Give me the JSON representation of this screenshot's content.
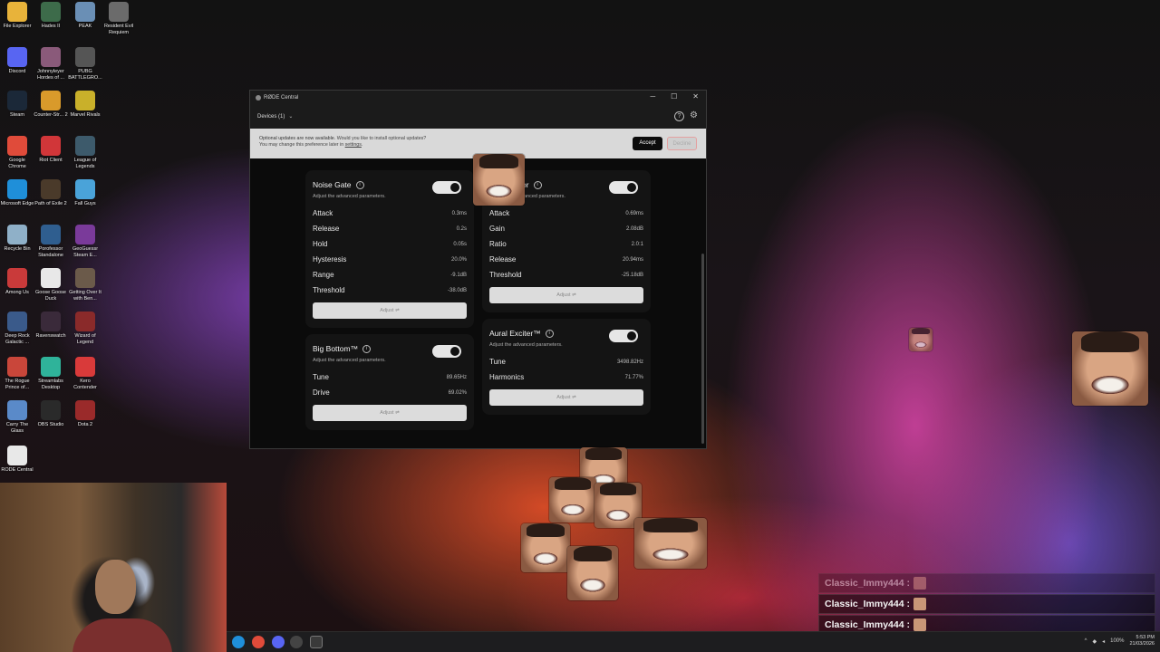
{
  "desktop": {
    "icons": [
      {
        "label": "File Explorer",
        "color": "#e8b33a"
      },
      {
        "label": "Hades II",
        "color": "#3d6b4a"
      },
      {
        "label": "PEAK",
        "color": "#6a8fb5"
      },
      {
        "label": "Resident Evil Requiem",
        "color": "#6b6b6b"
      },
      {
        "label": "Discord",
        "color": "#5865f2"
      },
      {
        "label": "Johnnyleyer Hordes of ...",
        "color": "#8a5a7a"
      },
      {
        "label": "PUBG BATTLEGRO...",
        "color": "#555555"
      },
      {
        "label": "Steam",
        "color": "#1b2838"
      },
      {
        "label": "Counter-Str... 2",
        "color": "#d99a2b"
      },
      {
        "label": "Marvel Rivals",
        "color": "#c9b02a"
      },
      {
        "label": "Google Chrome",
        "color": "#e04b3a"
      },
      {
        "label": "Riot Client",
        "color": "#d13639"
      },
      {
        "label": "League of Legends",
        "color": "#3d5a6b"
      },
      {
        "label": "Microsoft Edge",
        "color": "#1f8fd9"
      },
      {
        "label": "Path of Exile 2",
        "color": "#4a3a2a"
      },
      {
        "label": "Fall Guys",
        "color": "#4aa3d9"
      },
      {
        "label": "Recycle Bin",
        "color": "#8fb0c8"
      },
      {
        "label": "Porofessor Standalone",
        "color": "#2f5e8f"
      },
      {
        "label": "GeoGuessr Steam E...",
        "color": "#7a3a9a"
      },
      {
        "label": "Among Us",
        "color": "#c93a3a"
      },
      {
        "label": "Goose Goose Duck",
        "color": "#e8e8e8"
      },
      {
        "label": "Getting Over It with Ben...",
        "color": "#6b5a4a"
      },
      {
        "label": "Deep Rock Galactic ...",
        "color": "#3a5a8a"
      },
      {
        "label": "Ravenswatch",
        "color": "#3a2a3a"
      },
      {
        "label": "Wizard of Legend",
        "color": "#8a2a2a"
      },
      {
        "label": "The Rogue Prince of...",
        "color": "#c9463a"
      },
      {
        "label": "Streamlabs Desktop",
        "color": "#2fb39a"
      },
      {
        "label": "Kero Contender",
        "color": "#d93a3a"
      },
      {
        "label": "Carry The Glass",
        "color": "#5a8ac9"
      },
      {
        "label": "OBS Studio",
        "color": "#2a2a2a"
      },
      {
        "label": "Dota 2",
        "color": "#9a2a2a"
      },
      {
        "label": "RODE Central",
        "color": "#e8e8e8"
      }
    ]
  },
  "window": {
    "title": "RØDE Central",
    "controls": {
      "minimize": "─",
      "maximize": "☐",
      "close": "✕"
    },
    "devices_label": "Devices (1)",
    "devices_chevron": "⌄",
    "help_icon": "?",
    "settings_icon": "⚙"
  },
  "banner": {
    "line1_strong": "Optional updates are now available.",
    "line1_rest": " Would you like to install optional updates?",
    "line2_pre": "You may change this preference later in ",
    "line2_link": "settings",
    "line2_post": ".",
    "accept_label": "Accept",
    "decline_label": "Decline"
  },
  "panels": {
    "noise_gate": {
      "title": "Noise Gate",
      "subtitle": "Adjust the advanced parameters.",
      "params": [
        {
          "name": "Attack",
          "value": "0.3ms"
        },
        {
          "name": "Release",
          "value": "0.2s"
        },
        {
          "name": "Hold",
          "value": "0.05s"
        },
        {
          "name": "Hysteresis",
          "value": "20.0%"
        },
        {
          "name": "Range",
          "value": "-9.1dB"
        },
        {
          "name": "Threshold",
          "value": "-38.0dB"
        }
      ],
      "adjust_label": "Adjust ⇌"
    },
    "compressor": {
      "title": "or",
      "subtitle": "anced parameters.",
      "params": [
        {
          "name": "Attack",
          "value": "0.69ms"
        },
        {
          "name": "Gain",
          "value": "2.08dB"
        },
        {
          "name": "Ratio",
          "value": "2.0:1"
        },
        {
          "name": "Release",
          "value": "20.94ms"
        },
        {
          "name": "Threshold",
          "value": "-25.18dB"
        }
      ],
      "adjust_label": "Adjust ⇌"
    },
    "big_bottom": {
      "title": "Big Bottom™",
      "subtitle": "Adjust the advanced parameters.",
      "params": [
        {
          "name": "Tune",
          "value": "89.65Hz"
        },
        {
          "name": "Drive",
          "value": "69.02%"
        }
      ],
      "adjust_label": "Adjust ⇌"
    },
    "aural_exciter": {
      "title": "Aural Exciter™",
      "subtitle": "Adjust the advanced parameters.",
      "params": [
        {
          "name": "Tune",
          "value": "3498.82Hz"
        },
        {
          "name": "Harmonics",
          "value": "71.77%"
        }
      ],
      "adjust_label": "Adjust ⇌"
    }
  },
  "chat": {
    "lines": [
      {
        "user": "Classic_Immy444 :",
        "faded": true
      },
      {
        "user": "Classic_Immy444 :",
        "faded": false
      },
      {
        "user": "Classic_Immy444 :",
        "faded": false
      },
      {
        "user": "Classic_Immy444 :",
        "faded": true
      }
    ]
  },
  "taskbar": {
    "tray_chevron": "^",
    "battery": "100%",
    "time": "5:53 PM",
    "date": "21/03/2026"
  }
}
